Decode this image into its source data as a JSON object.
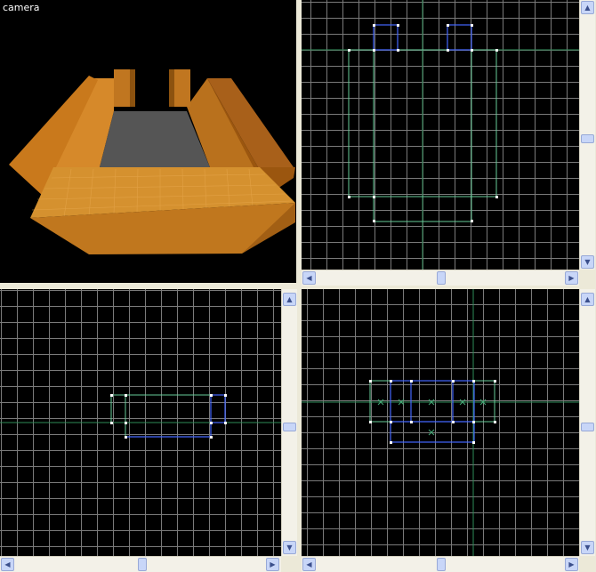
{
  "viewports": {
    "camera": {
      "label": "camera"
    },
    "top": {
      "label": ""
    },
    "side": {
      "label": ""
    },
    "front": {
      "label": ""
    }
  },
  "scrollbars": {
    "up_arrow": "▲",
    "down_arrow": "▼",
    "left_arrow": "◀",
    "right_arrow": "▶"
  },
  "colors": {
    "background": "#000000",
    "grid": "#7a7a7a",
    "axis": "#2e8b57",
    "brush_green": "#66cc99",
    "brush_blue": "#4466ff",
    "vertex": "#ffffff",
    "wood_light": "#d0892c",
    "wood_dark": "#8a4e0c",
    "floor": "#555555"
  }
}
